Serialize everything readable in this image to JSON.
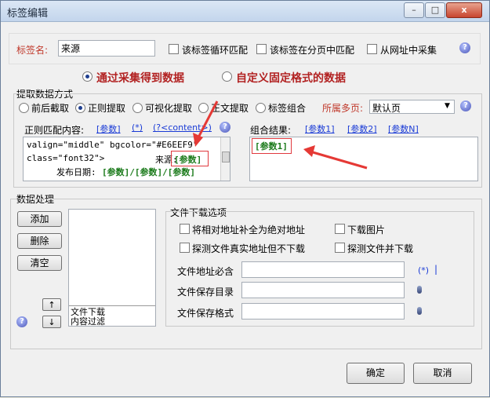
{
  "window": {
    "title": "标签编辑",
    "min_glyph": "–",
    "max_glyph": "□",
    "close_glyph": "x"
  },
  "tag": {
    "name_label": "标签名:",
    "name_value": "来源",
    "loop_match": "该标签循环匹配",
    "page_match": "该标签在分页中匹配",
    "url_collect": "从网址中采集"
  },
  "source_mode": {
    "collect": "通过采集得到数据",
    "custom": "自定义固定格式的数据"
  },
  "extract": {
    "title": "提取数据方式",
    "options": [
      "前后截取",
      "正则提取",
      "可视化提取",
      "正文提取",
      "标签组合"
    ],
    "multi_page_label": "所属多页:",
    "multi_page_value": "默认页"
  },
  "regex": {
    "label": "正则匹配内容:",
    "links": [
      "[参数]",
      "(*)",
      "(?<content>)"
    ],
    "lines": [
      "valign=\"middle\" bgcolor=\"#E6EEF9\"",
      "class=\"font32\">",
      "来源:",
      "[参数]",
      "发布日期:",
      "[参数]/[参数]/[参数]"
    ]
  },
  "combine": {
    "label": "组合结果:",
    "links": [
      "[参数1]",
      "[参数2]",
      "[参数N]"
    ],
    "value": "[参数1]"
  },
  "process": {
    "title": "数据处理",
    "add": "添加",
    "delete": "删除",
    "clear": "清空",
    "up": "↑",
    "down": "↓",
    "list": [
      "文件下载",
      "内容过滤"
    ]
  },
  "download": {
    "title": "文件下载选项",
    "relative_to_abs": "将相对地址补全为绝对地址",
    "download_images": "下载图片",
    "probe_no_download": "探测文件真实地址但不下载",
    "probe_and_download": "探测文件并下载",
    "must_contain": "文件地址必含",
    "save_dir": "文件保存目录",
    "save_format": "文件保存格式",
    "wildcard": "(*)",
    "cursor": "|"
  },
  "footer": {
    "ok": "确定",
    "cancel": "取消"
  },
  "colors": {
    "arrow": "#e53935",
    "label_red": "#c0392b",
    "param_green": "#1a7a1a"
  }
}
